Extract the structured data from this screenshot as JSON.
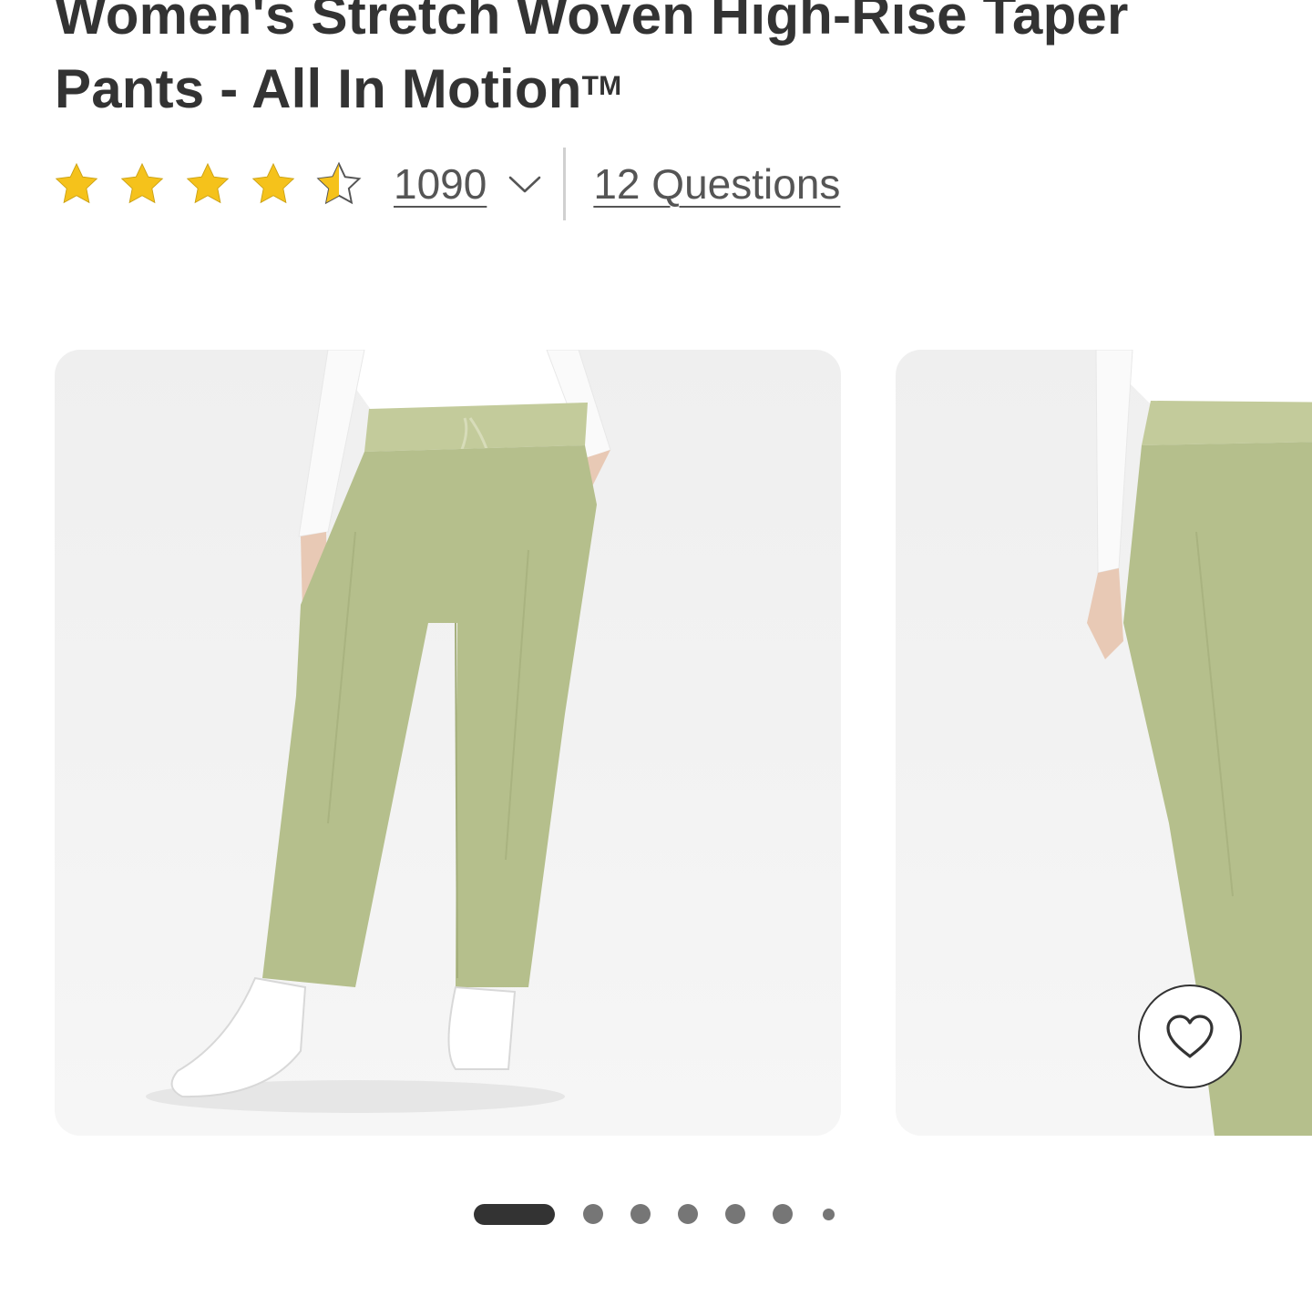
{
  "product": {
    "title": "Women's Stretch Woven High-Rise Taper Pants - All In Motion",
    "trademark": "TM"
  },
  "rating": {
    "stars": 4.5,
    "max_stars": 5,
    "review_count": "1090",
    "questions_link": "12 Questions"
  },
  "gallery": {
    "images": [
      {
        "subject": "olive green tapered pants, front view with white sneakers"
      },
      {
        "subject": "olive green tapered pants, side view"
      }
    ],
    "favorite_icon": "heart-outline-icon",
    "pagination": {
      "active_index": 0,
      "total_dots": 7
    }
  },
  "colors": {
    "text": "#333333",
    "link": "#555555",
    "star": "#f5c21b",
    "product_green": "#b5bf8c",
    "card_background": "#f0f0f0"
  }
}
